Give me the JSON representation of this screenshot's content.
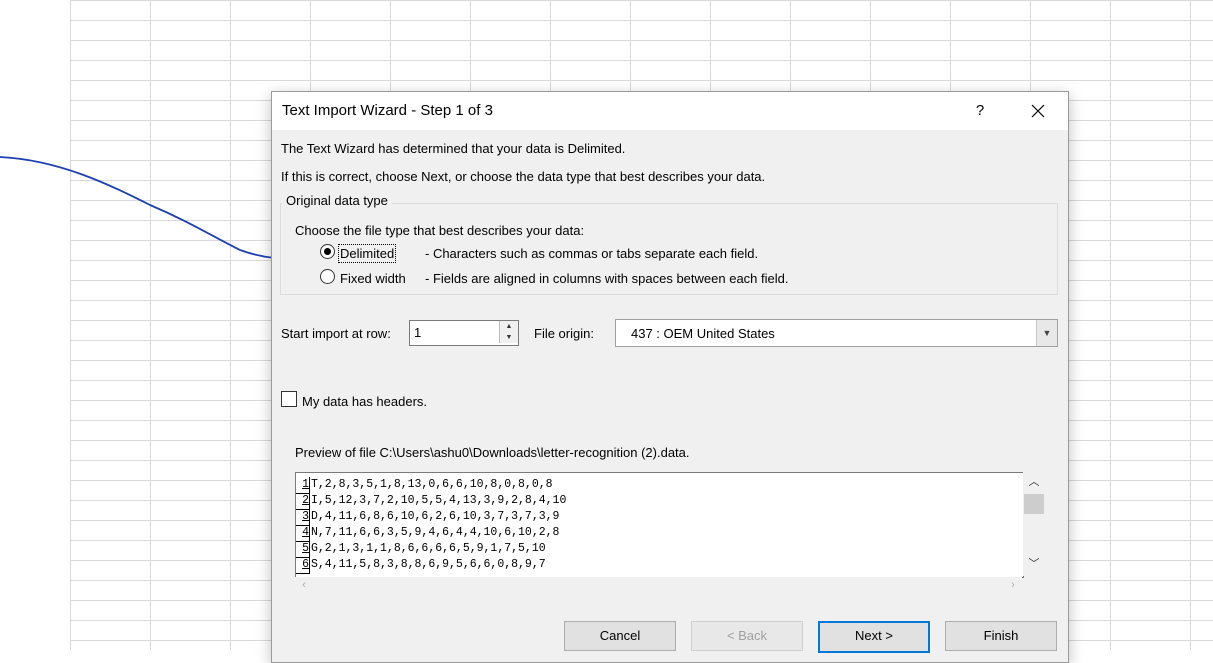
{
  "dialog": {
    "title": "Text Import Wizard - Step 1 of 3",
    "help_label": "?",
    "intro_line1": "The Text Wizard has determined that your data is Delimited.",
    "intro_line2": "If this is correct, choose Next, or choose the data type that best describes your data.",
    "original_data_type": {
      "legend": "Original data type",
      "prompt": "Choose the file type that best describes your data:",
      "options": [
        {
          "label": "Delimited",
          "description": "- Characters such as commas or tabs separate each field.",
          "selected": true
        },
        {
          "label": "Fixed width",
          "description": "- Fields are aligned in columns with spaces between each field.",
          "selected": false
        }
      ]
    },
    "start_import": {
      "label": "Start import at row:",
      "value": "1"
    },
    "file_origin": {
      "label": "File origin:",
      "value": "437 : OEM United States"
    },
    "headers_checkbox": {
      "label": "My data has headers.",
      "checked": false
    },
    "preview": {
      "label": "Preview of file C:\\Users\\ashu0\\Downloads\\letter-recognition (2).data.",
      "rows": [
        {
          "num": "1",
          "text": "T,2,8,3,5,1,8,13,0,6,6,10,8,0,8,0,8"
        },
        {
          "num": "2",
          "text": "I,5,12,3,7,2,10,5,5,4,13,3,9,2,8,4,10"
        },
        {
          "num": "3",
          "text": "D,4,11,6,8,6,10,6,2,6,10,3,7,3,7,3,9"
        },
        {
          "num": "4",
          "text": "N,7,11,6,6,3,5,9,4,6,4,4,10,6,10,2,8"
        },
        {
          "num": "5",
          "text": "G,2,1,3,1,1,8,6,6,6,6,5,9,1,7,5,10"
        },
        {
          "num": "6",
          "text": "S,4,11,5,8,3,8,8,6,9,5,6,6,0,8,9,7"
        }
      ]
    },
    "buttons": {
      "cancel": "Cancel",
      "back": "< Back",
      "next": "Next >",
      "finish": "Finish"
    }
  },
  "colors": {
    "annotation_ink": "#1e3fb4",
    "default_button_border": "#0078d7"
  }
}
